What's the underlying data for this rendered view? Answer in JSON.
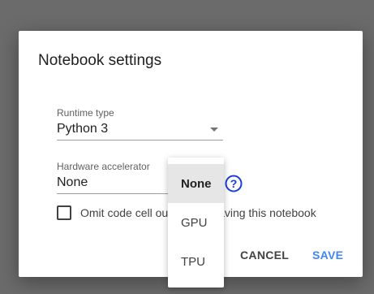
{
  "dialog": {
    "title": "Notebook settings",
    "runtime": {
      "label": "Runtime type",
      "value": "Python 3"
    },
    "accelerator": {
      "label": "Hardware accelerator",
      "value": "None"
    },
    "omit_output": {
      "label_before": "Omit code cell out",
      "label_after": "aving this notebook",
      "checked": false
    },
    "buttons": {
      "cancel": "CANCEL",
      "save": "SAVE"
    }
  },
  "dropdown": {
    "selected": "None",
    "options": [
      "None",
      "GPU",
      "TPU"
    ]
  },
  "colors": {
    "accent": "#4285f4",
    "help_icon": "#1a3ed6",
    "backdrop": "#6b6b6b"
  },
  "icons": {
    "help": "question-circle-icon",
    "caret": "caret-down-icon"
  }
}
